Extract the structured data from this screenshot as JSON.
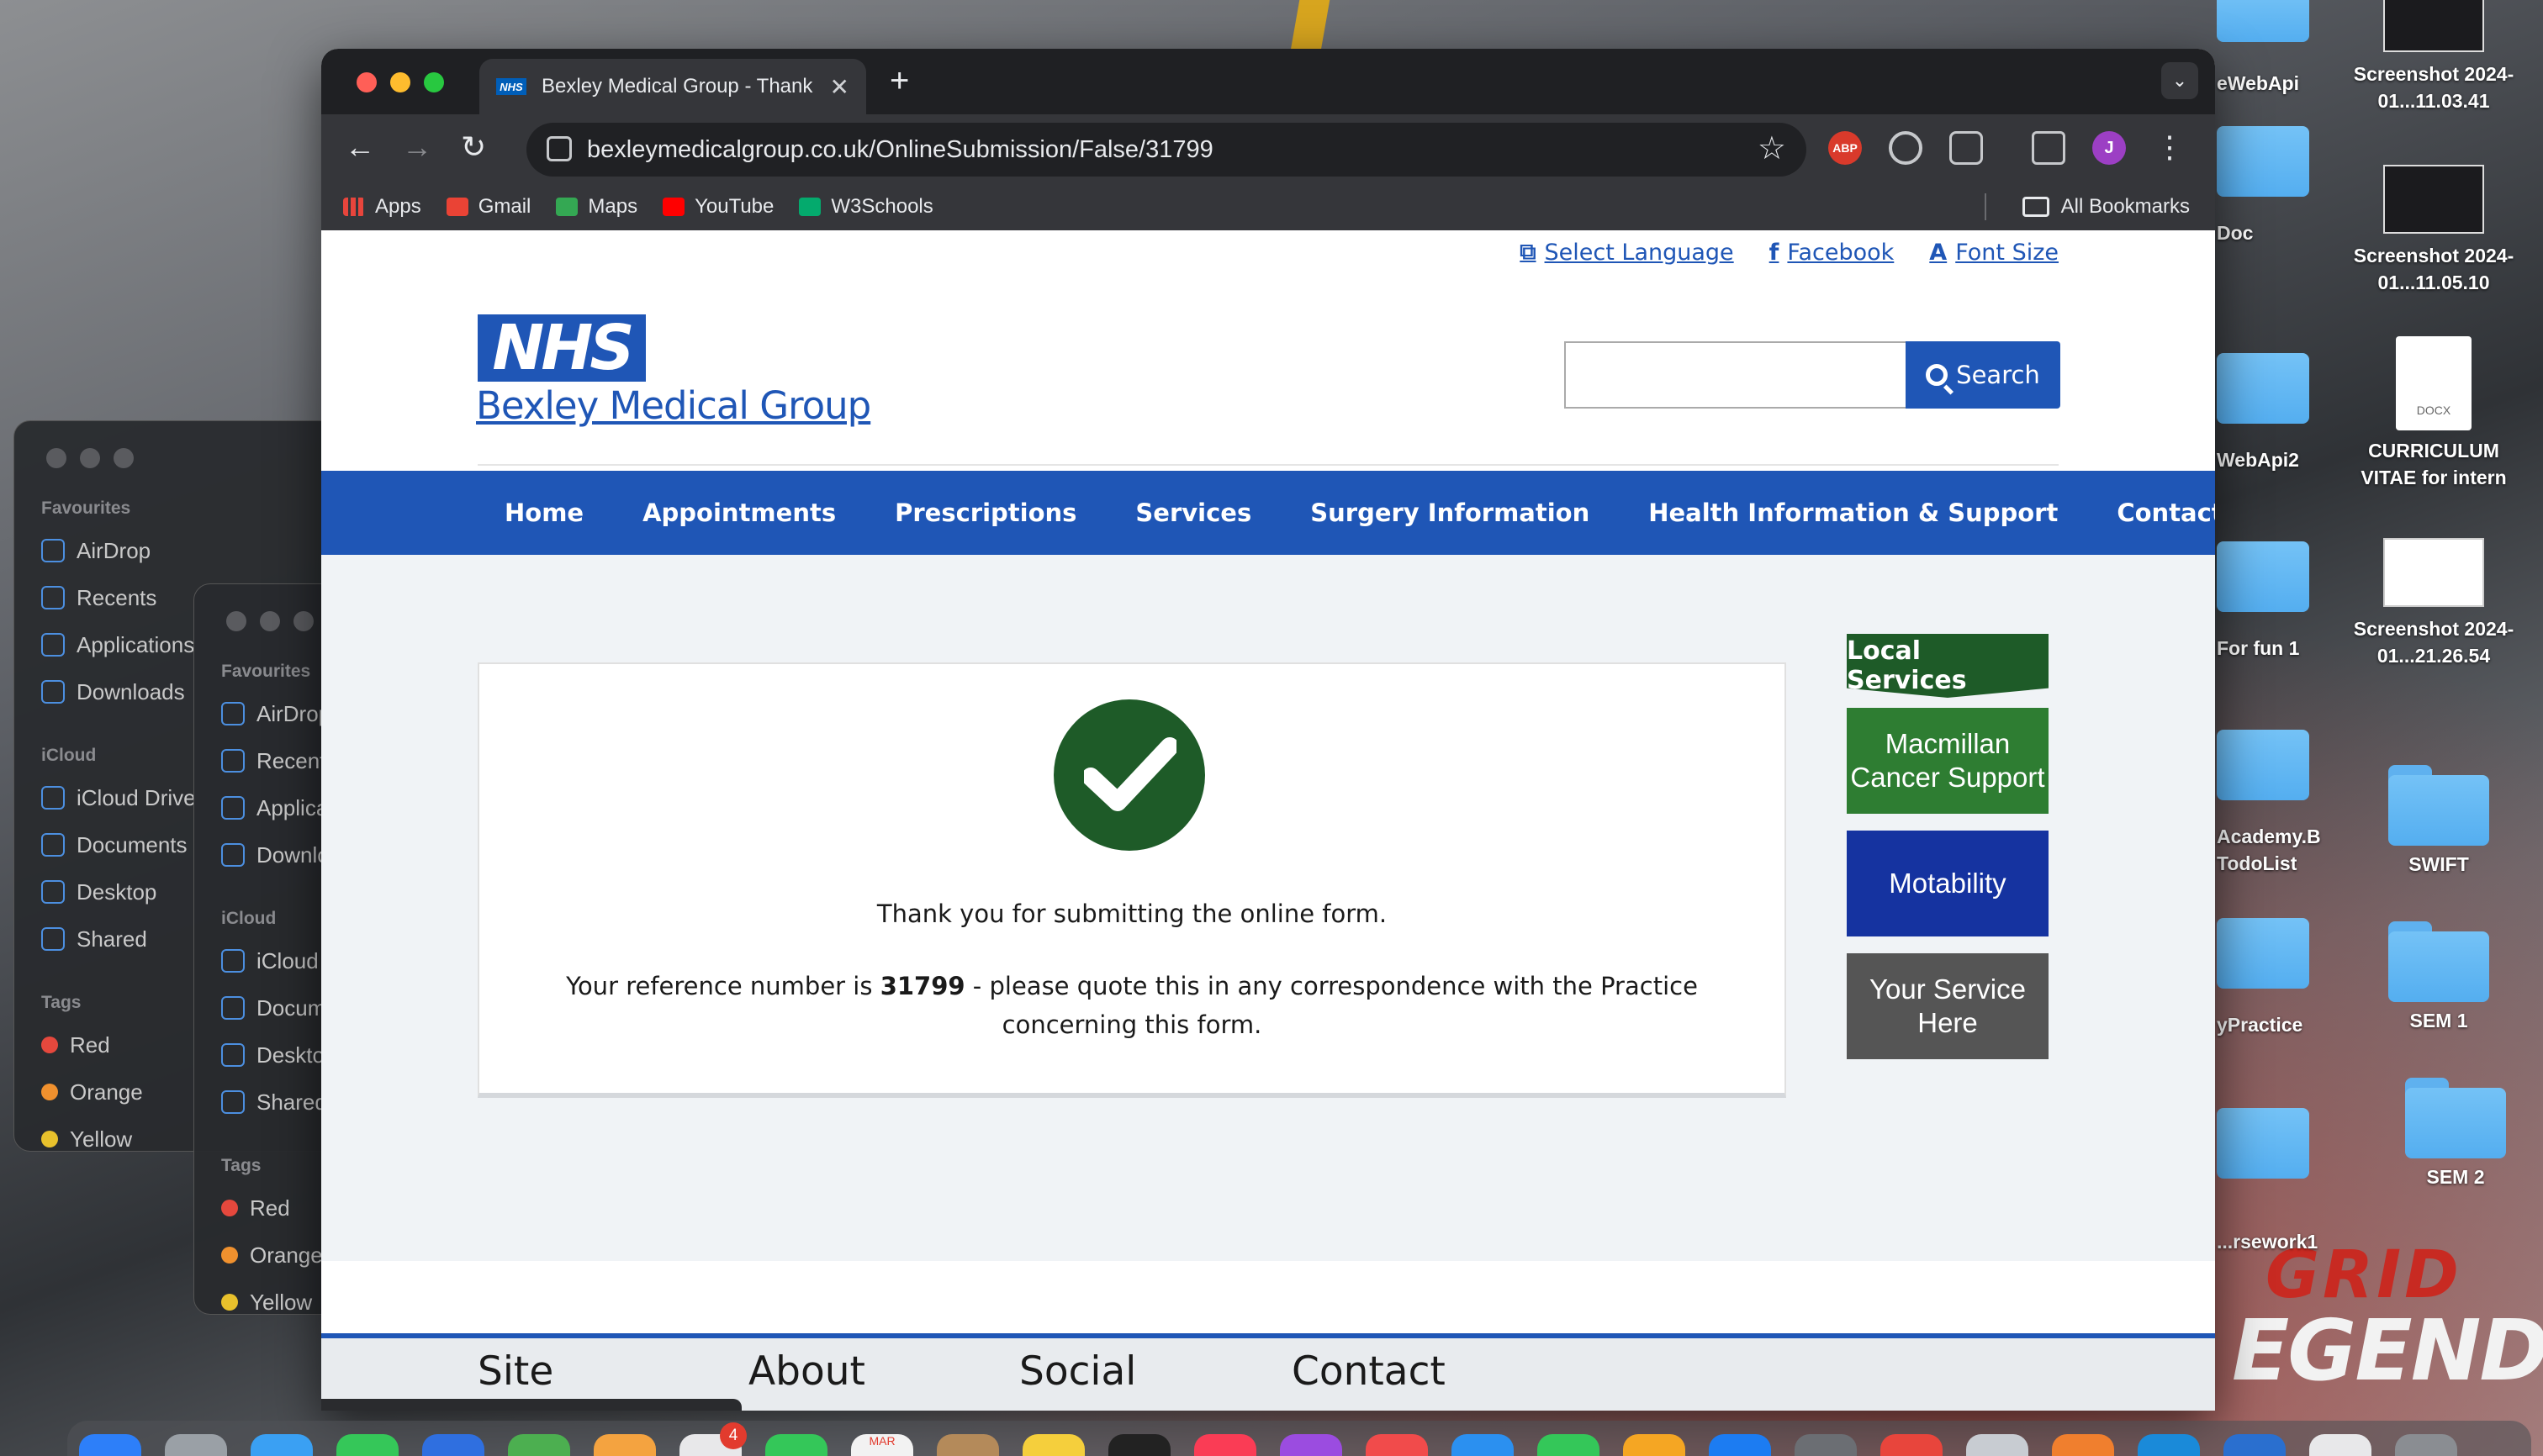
{
  "browser": {
    "tab_title": "Bexley Medical Group - Thank",
    "url": "bexleymedicalgroup.co.uk/OnlineSubmission/False/31799",
    "bookmarks": [
      "Apps",
      "Gmail",
      "Maps",
      "YouTube",
      "W3Schools"
    ],
    "all_bookmarks": "All Bookmarks",
    "extensions": {
      "abp": "ABP",
      "profile": "J"
    }
  },
  "site": {
    "util_links": [
      "Select Language",
      "Facebook",
      "Font Size"
    ],
    "logo": "NHS",
    "practice_name": "Bexley Medical Group",
    "search_label": "Search",
    "nav": [
      "Home",
      "Appointments",
      "Prescriptions",
      "Services",
      "Surgery Information",
      "Health Information & Support",
      "Contact"
    ],
    "confirmation": {
      "thanks": "Thank you for submitting the online form.",
      "ref_prefix": "Your reference number is ",
      "ref_number": "31799",
      "ref_suffix": " - please quote this in any correspondence with the Practice concerning this form."
    },
    "sidebar": {
      "heading": "Local Services",
      "items": [
        {
          "label": "Macmillan Cancer Support",
          "color": "#2e7d32"
        },
        {
          "label": "Motability",
          "color": "#1533a0"
        },
        {
          "label": "Your Service Here",
          "color": "#555555"
        }
      ]
    },
    "footer": [
      "Site",
      "About",
      "Social",
      "Contact"
    ]
  },
  "finder": {
    "favourites_label": "Favourites",
    "favourites": [
      "AirDrop",
      "Recents",
      "Applications",
      "Downloads"
    ],
    "icloud_label": "iCloud",
    "icloud": [
      "iCloud Drive",
      "Documents",
      "Desktop",
      "Shared"
    ],
    "tags_label": "Tags",
    "tags": [
      {
        "name": "Red",
        "color": "#e5483d"
      },
      {
        "name": "Orange",
        "color": "#f0912e"
      },
      {
        "name": "Yellow",
        "color": "#e8c12c"
      }
    ]
  },
  "desktop": {
    "icons": [
      {
        "label": "Screenshot 2024-01...11.03.41"
      },
      {
        "label": "Screenshot 2024-01...11.05.10"
      },
      {
        "label": "CURRICULUM VITAE for intern",
        "doc": "DOCX"
      },
      {
        "label": "Screenshot 2024-01...21.26.54"
      },
      {
        "label": "SWIFT"
      },
      {
        "label": "SEM 1"
      },
      {
        "label": "SEM 2"
      }
    ],
    "partial_labels": [
      "eWebApi",
      "Doc",
      "WebApi2",
      "For fun 1",
      "Academy.B",
      "TodoList",
      "yPractice",
      "...rsework1"
    ],
    "wallpaper_logo": [
      "GRID",
      "EGENDS"
    ]
  },
  "dock": {
    "calendar_month": "MAR",
    "mail_badge": "4"
  }
}
